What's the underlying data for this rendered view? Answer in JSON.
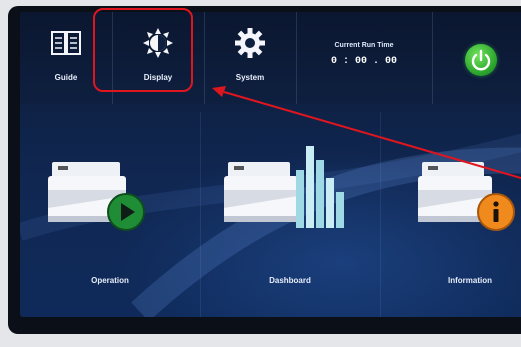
{
  "topbar": {
    "nav": [
      {
        "label": "Guide",
        "icon": "book-icon"
      },
      {
        "label": "Display",
        "icon": "brightness-icon"
      },
      {
        "label": "System",
        "icon": "gear-icon"
      }
    ],
    "runtime": {
      "title": "Current Run Time",
      "value": "0 : 00 . 00"
    },
    "power": {
      "icon": "power-icon",
      "color": "#2fae2f"
    }
  },
  "main": {
    "tiles": [
      {
        "label": "Operation",
        "icon": "play-icon",
        "badge_color": "#27a03a"
      },
      {
        "label": "Dashboard",
        "icon": "bar-chart-icon",
        "badge_color": "#9fd9e6"
      },
      {
        "label": "Information",
        "icon": "info-icon",
        "badge_color": "#f08a1c"
      }
    ]
  },
  "annotation": {
    "highlight_color": "#e0161f",
    "highlighted_item": "Display"
  }
}
